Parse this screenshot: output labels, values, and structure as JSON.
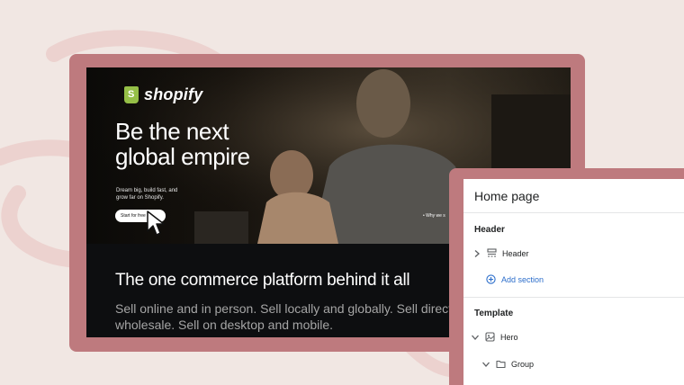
{
  "hero": {
    "brand": "shopify",
    "title_line1": "Be the next",
    "title_line2": "global empire",
    "subtitle": "Dream big, build fast, and grow far on Shopify.",
    "cta_label": "Start for free",
    "why_link": "• Why we s"
  },
  "lower": {
    "title": "The one commerce platform behind it all",
    "text": "Sell online and in person. Sell locally and globally. Sell direct and wholesale. Sell on desktop and mobile."
  },
  "panel": {
    "title": "Home page",
    "header_section": "Header",
    "header_item": "Header",
    "add_section": "Add section",
    "template_section": "Template",
    "hero_item": "Hero",
    "group_item": "Group"
  },
  "colors": {
    "background": "#f1e7e3",
    "frame": "#be7a7e",
    "brand_green": "#95bf47",
    "link_blue": "#2c6ecb"
  }
}
